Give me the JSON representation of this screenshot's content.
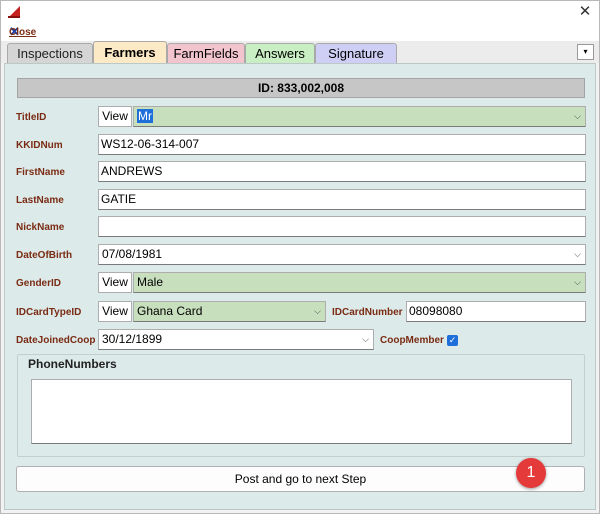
{
  "window": {
    "close_glyph": "✕"
  },
  "menu": {
    "close_label": "Close"
  },
  "tabs": [
    {
      "label": "Inspections"
    },
    {
      "label": "Farmers"
    },
    {
      "label": "FarmFields"
    },
    {
      "label": "Answers"
    },
    {
      "label": "Signature"
    }
  ],
  "tabs_menu_glyph": "▾",
  "form": {
    "id_text": "ID: 833,002,008",
    "view_label": "View",
    "fields": {
      "title_id": {
        "label": "TitleID",
        "value": "Mr"
      },
      "kkid_num": {
        "label": "KKIDNum",
        "value": "WS12-06-314-007"
      },
      "first_name": {
        "label": "FirstName",
        "value": "ANDREWS"
      },
      "last_name": {
        "label": "LastName",
        "value": "GATIE"
      },
      "nick_name": {
        "label": "NickName",
        "value": ""
      },
      "date_of_birth": {
        "label": "DateOfBirth",
        "value": "07/08/1981"
      },
      "gender_id": {
        "label": "GenderID",
        "value": "Male"
      },
      "id_card_type_id": {
        "label": "IDCardTypeID",
        "value": "Ghana Card"
      },
      "id_card_number": {
        "label": "IDCardNumber",
        "value": "08098080"
      },
      "date_joined_coop": {
        "label": "DateJoinedCoop",
        "value": "30/12/1899"
      },
      "coop_member": {
        "label": "CoopMember",
        "checked": true
      }
    },
    "phone_numbers_title": "PhoneNumbers",
    "post_button_label": "Post and go to next Step"
  },
  "annotation_badge": "1",
  "colors": {
    "label_text": "#7a2b13",
    "lookup_combo_bg": "#c8dfbd",
    "panel_bg": "#dceaea",
    "selection": "#1e6fd9",
    "badge": "#e53a3a"
  }
}
